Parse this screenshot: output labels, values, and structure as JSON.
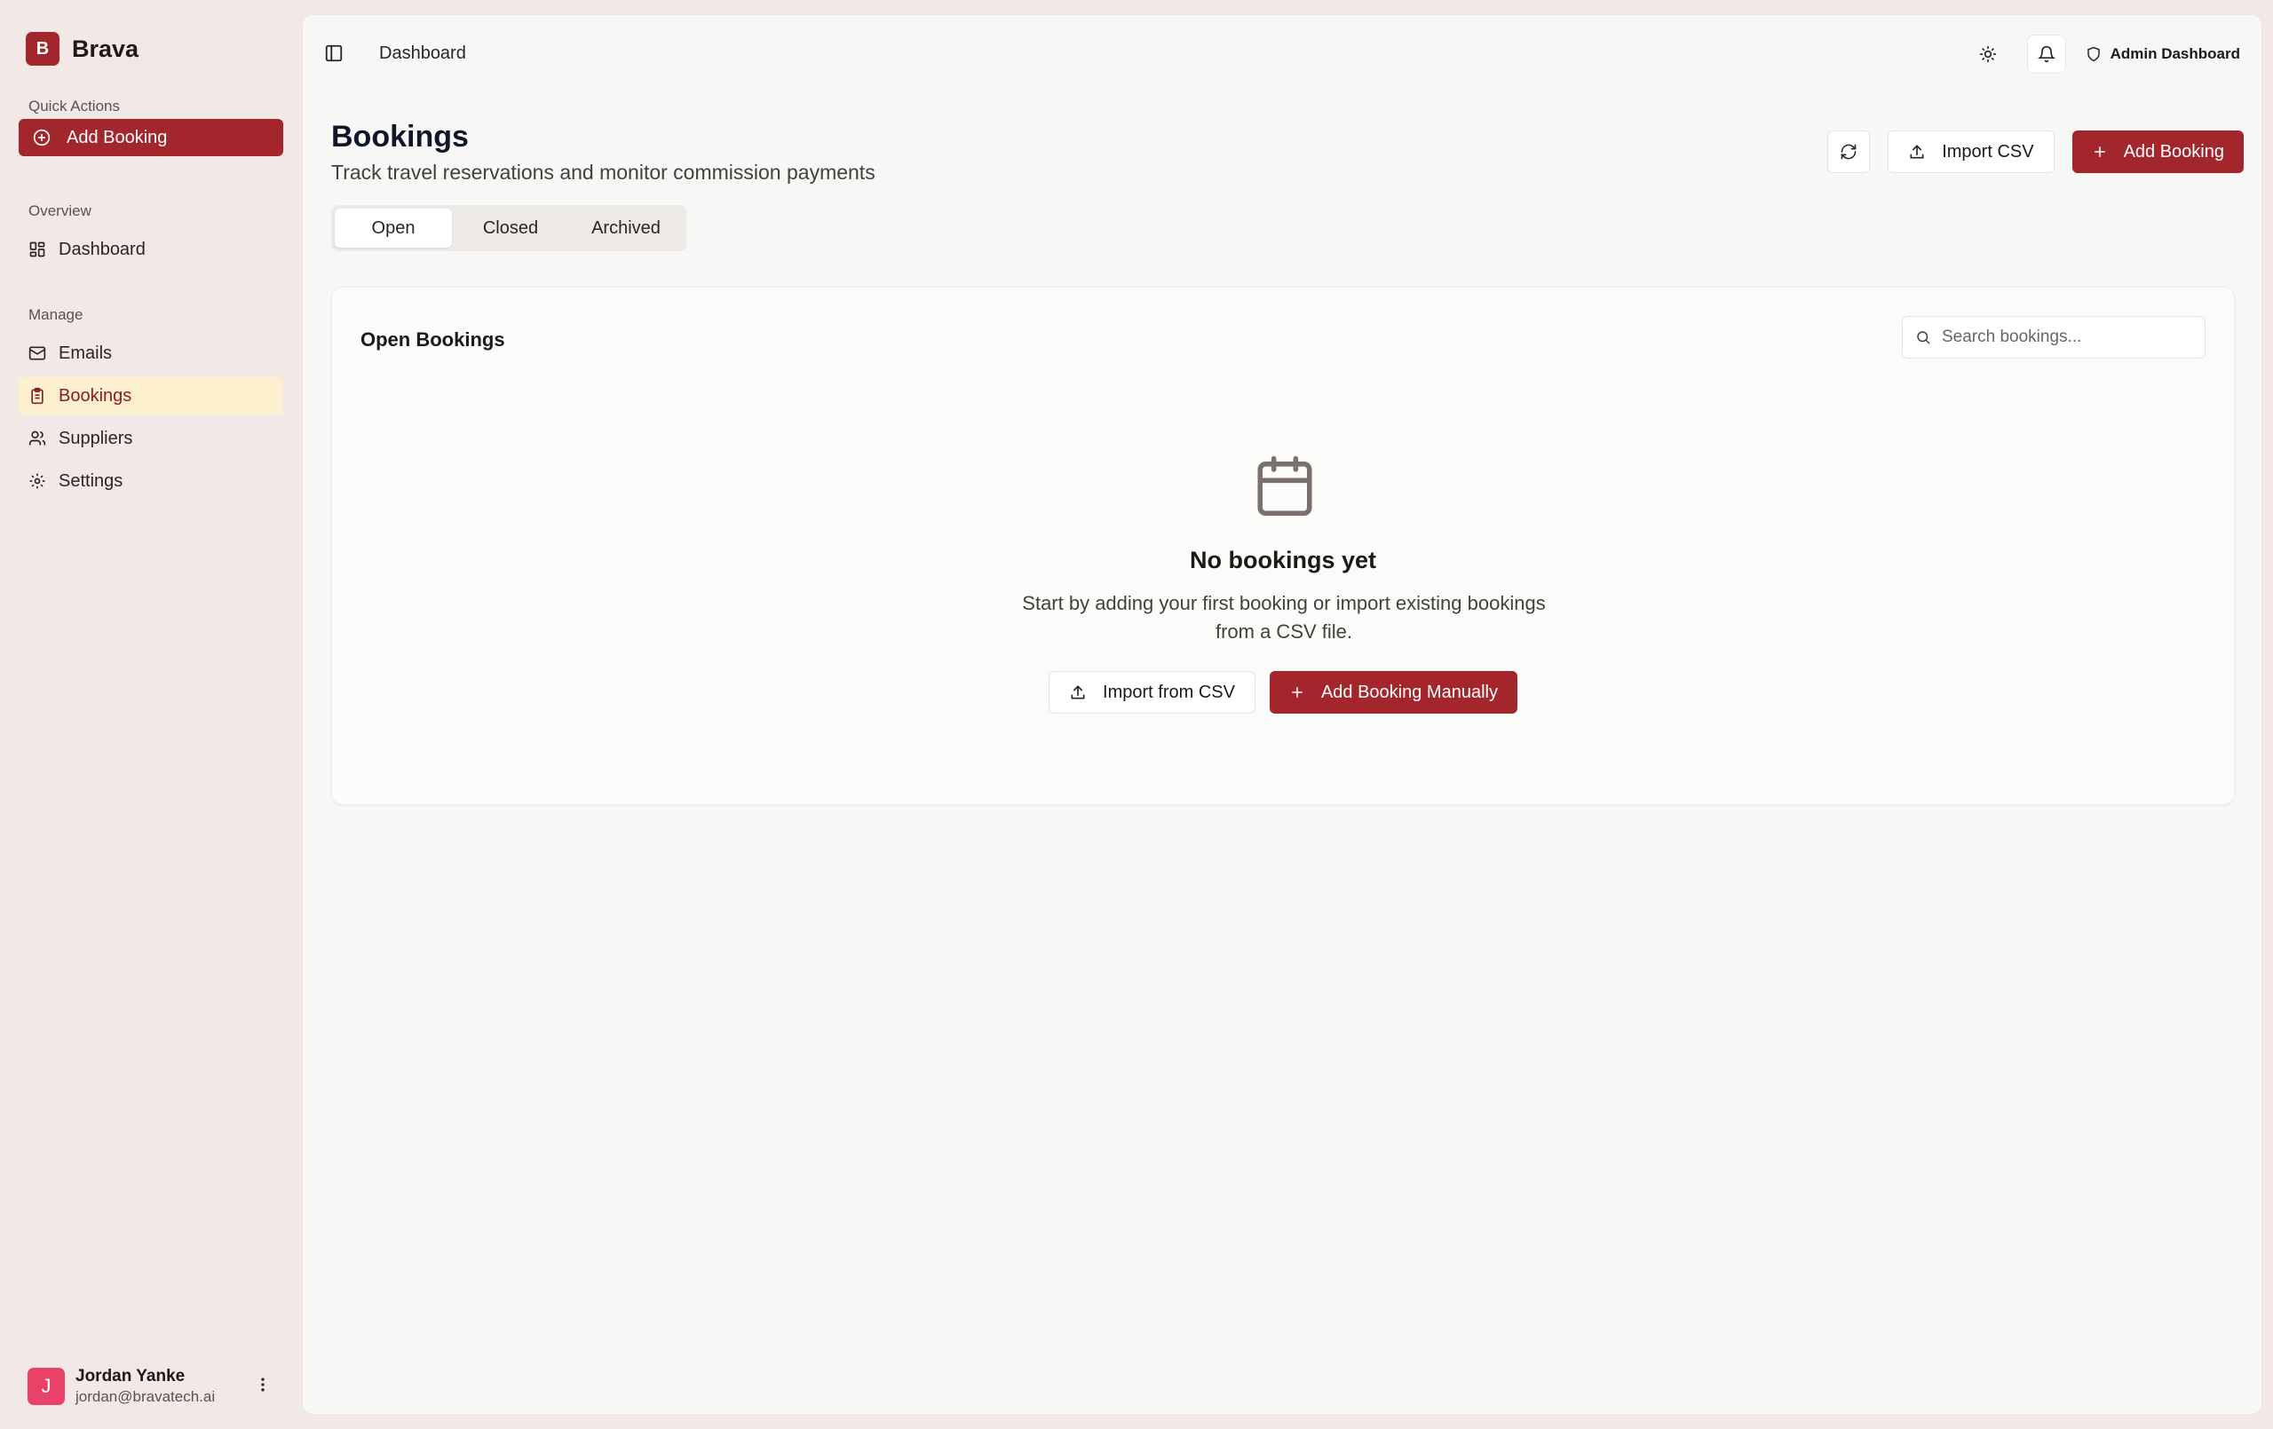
{
  "brand": {
    "logo_letter": "B",
    "name": "Brava",
    "accent_color": "#a3262d"
  },
  "sidebar": {
    "quick_actions_label": "Quick Actions",
    "add_booking_label": "Add Booking",
    "overview_label": "Overview",
    "dashboard_label": "Dashboard",
    "manage_label": "Manage",
    "items": [
      {
        "label": "Emails",
        "icon": "mail-icon"
      },
      {
        "label": "Bookings",
        "icon": "clipboard-icon",
        "active": true
      },
      {
        "label": "Suppliers",
        "icon": "users-icon"
      },
      {
        "label": "Settings",
        "icon": "gear-icon"
      }
    ]
  },
  "user": {
    "initial": "J",
    "name": "Jordan Yanke",
    "email": "jordan@bravatech.ai"
  },
  "topbar": {
    "breadcrumb": "Dashboard",
    "admin_label": "Admin Dashboard"
  },
  "page": {
    "title": "Bookings",
    "subtitle": "Track travel reservations and monitor commission payments",
    "import_csv_label": "Import CSV",
    "add_booking_label": "Add Booking"
  },
  "tabs": [
    {
      "label": "Open",
      "active": true
    },
    {
      "label": "Closed",
      "active": false
    },
    {
      "label": "Archived",
      "active": false
    }
  ],
  "card": {
    "title": "Open Bookings",
    "search_placeholder": "Search bookings...",
    "empty_title": "No bookings yet",
    "empty_desc": "Start by adding your first booking or import existing bookings from a CSV file.",
    "import_label": "Import from CSV",
    "add_manual_label": "Add Booking Manually"
  }
}
